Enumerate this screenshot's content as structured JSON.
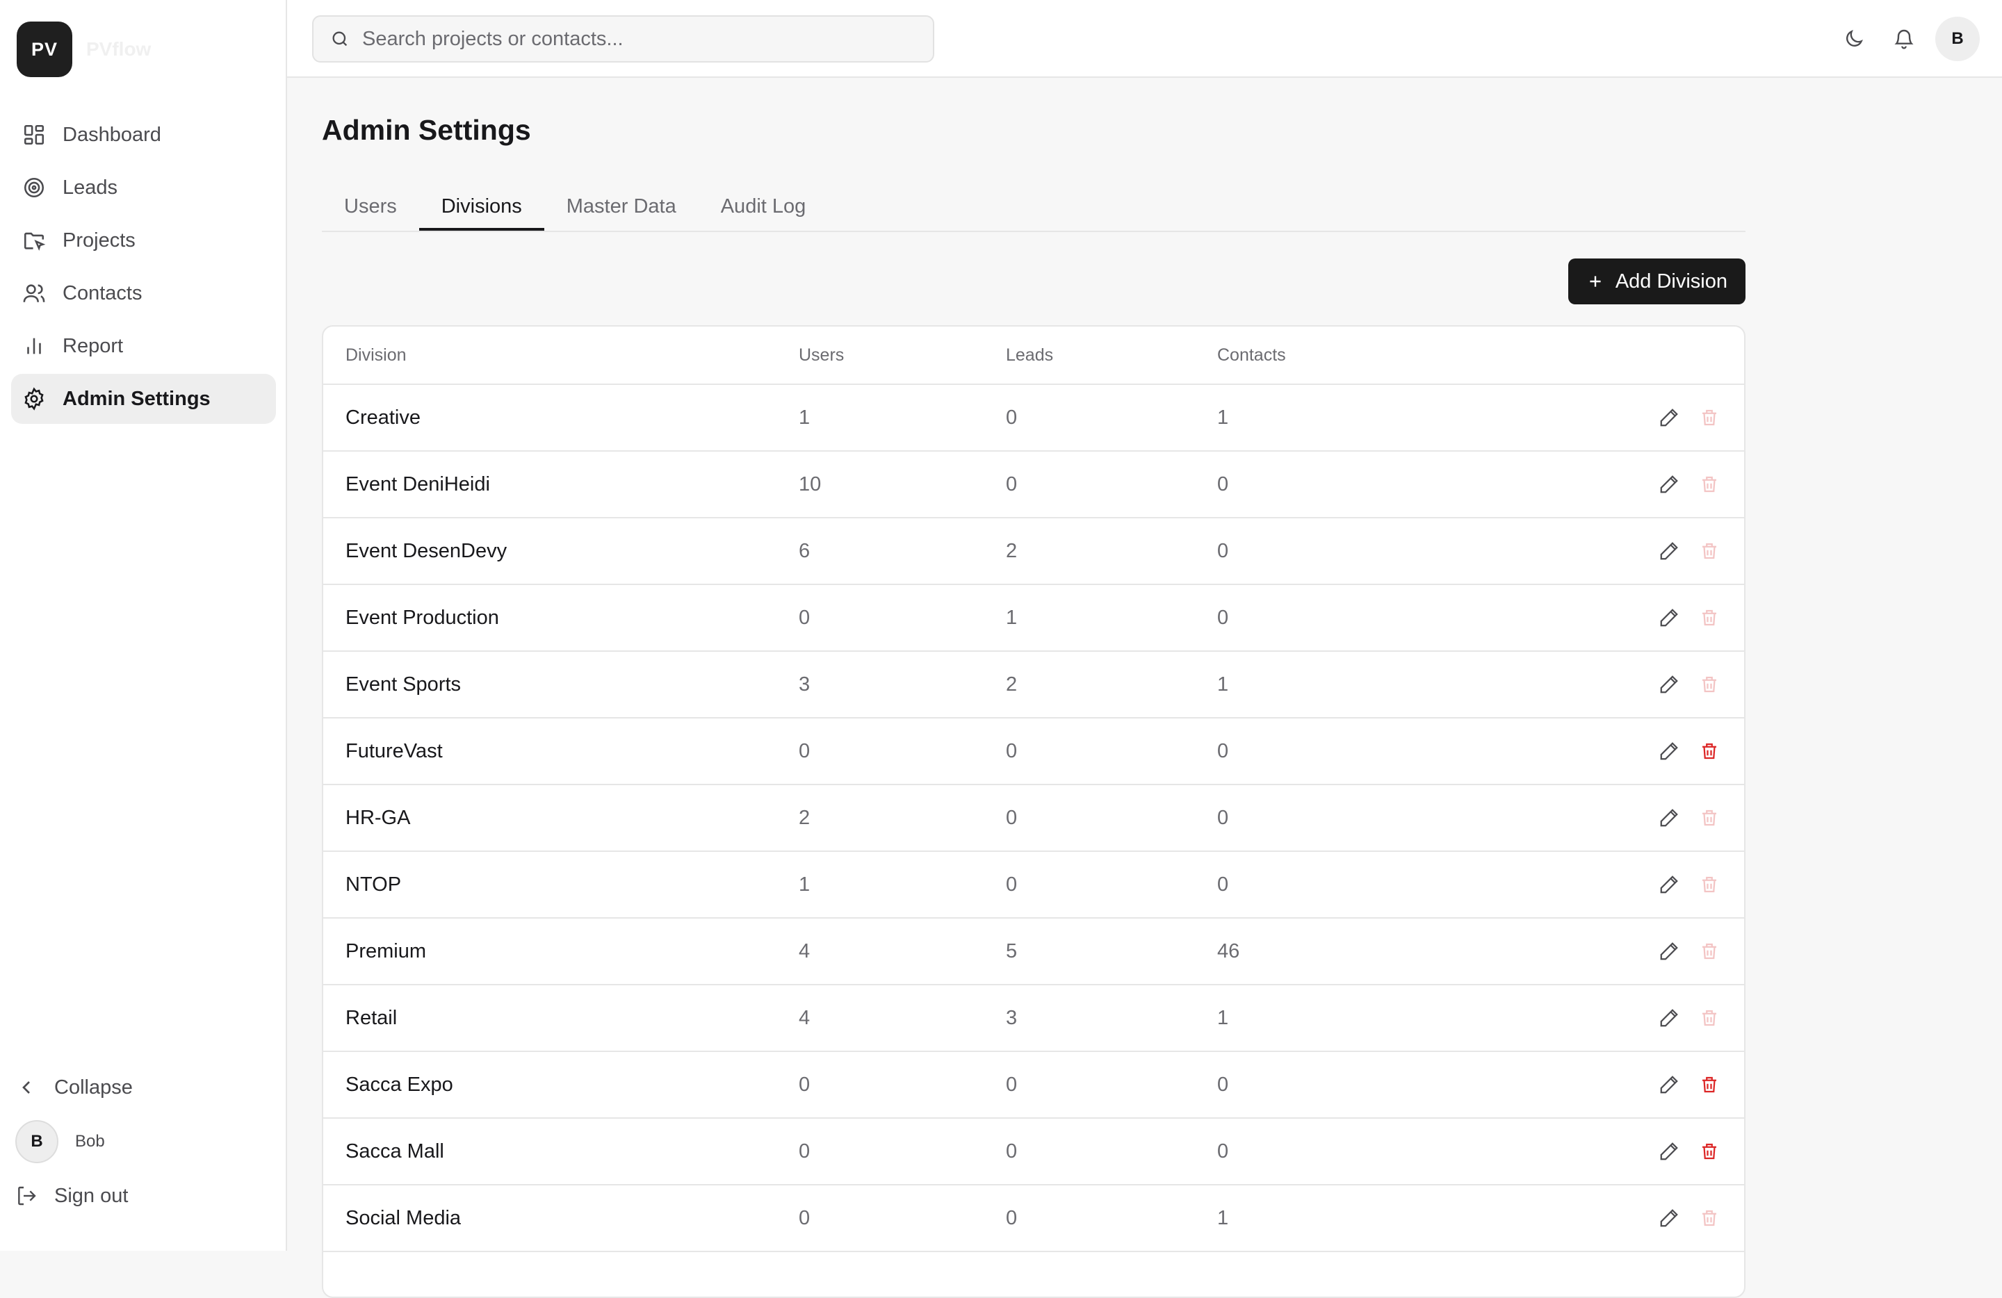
{
  "brand": {
    "initials": "PV",
    "name": "PVflow"
  },
  "sidebar": {
    "items": [
      {
        "label": "Dashboard",
        "icon": "dashboard-icon",
        "active": false
      },
      {
        "label": "Leads",
        "icon": "target-icon",
        "active": false
      },
      {
        "label": "Projects",
        "icon": "folder-icon",
        "active": false
      },
      {
        "label": "Contacts",
        "icon": "users-icon",
        "active": false
      },
      {
        "label": "Report",
        "icon": "bar-chart-icon",
        "active": false
      },
      {
        "label": "Admin Settings",
        "icon": "gear-icon",
        "active": true
      }
    ],
    "collapse_label": "Collapse",
    "user": {
      "initial": "B",
      "name": "Bob"
    },
    "signout_label": "Sign out"
  },
  "header": {
    "search_placeholder": "Search projects or contacts...",
    "avatar_initial": "B"
  },
  "page": {
    "title": "Admin Settings",
    "tabs": [
      {
        "label": "Users",
        "active": false
      },
      {
        "label": "Divisions",
        "active": true
      },
      {
        "label": "Master Data",
        "active": false
      },
      {
        "label": "Audit Log",
        "active": false
      }
    ],
    "add_button_label": "Add Division"
  },
  "table": {
    "columns": [
      "Division",
      "Users",
      "Leads",
      "Contacts"
    ],
    "rows": [
      {
        "division": "Creative",
        "users": "1",
        "leads": "0",
        "contacts": "1",
        "deletable": false
      },
      {
        "division": "Event DeniHeidi",
        "users": "10",
        "leads": "0",
        "contacts": "0",
        "deletable": false
      },
      {
        "division": "Event DesenDevy",
        "users": "6",
        "leads": "2",
        "contacts": "0",
        "deletable": false
      },
      {
        "division": "Event Production",
        "users": "0",
        "leads": "1",
        "contacts": "0",
        "deletable": false
      },
      {
        "division": "Event Sports",
        "users": "3",
        "leads": "2",
        "contacts": "1",
        "deletable": false
      },
      {
        "division": "FutureVast",
        "users": "0",
        "leads": "0",
        "contacts": "0",
        "deletable": true
      },
      {
        "division": "HR-GA",
        "users": "2",
        "leads": "0",
        "contacts": "0",
        "deletable": false
      },
      {
        "division": "NTOP",
        "users": "1",
        "leads": "0",
        "contacts": "0",
        "deletable": false
      },
      {
        "division": "Premium",
        "users": "4",
        "leads": "5",
        "contacts": "46",
        "deletable": false
      },
      {
        "division": "Retail",
        "users": "4",
        "leads": "3",
        "contacts": "1",
        "deletable": false
      },
      {
        "division": "Sacca Expo",
        "users": "0",
        "leads": "0",
        "contacts": "0",
        "deletable": true
      },
      {
        "division": "Sacca Mall",
        "users": "0",
        "leads": "0",
        "contacts": "0",
        "deletable": true
      },
      {
        "division": "Social Media",
        "users": "0",
        "leads": "0",
        "contacts": "1",
        "deletable": false
      }
    ]
  },
  "colors": {
    "delete_enabled": "#dc2626",
    "delete_disabled": "#f3c4c4",
    "primary_button": "#1a1a1a"
  }
}
